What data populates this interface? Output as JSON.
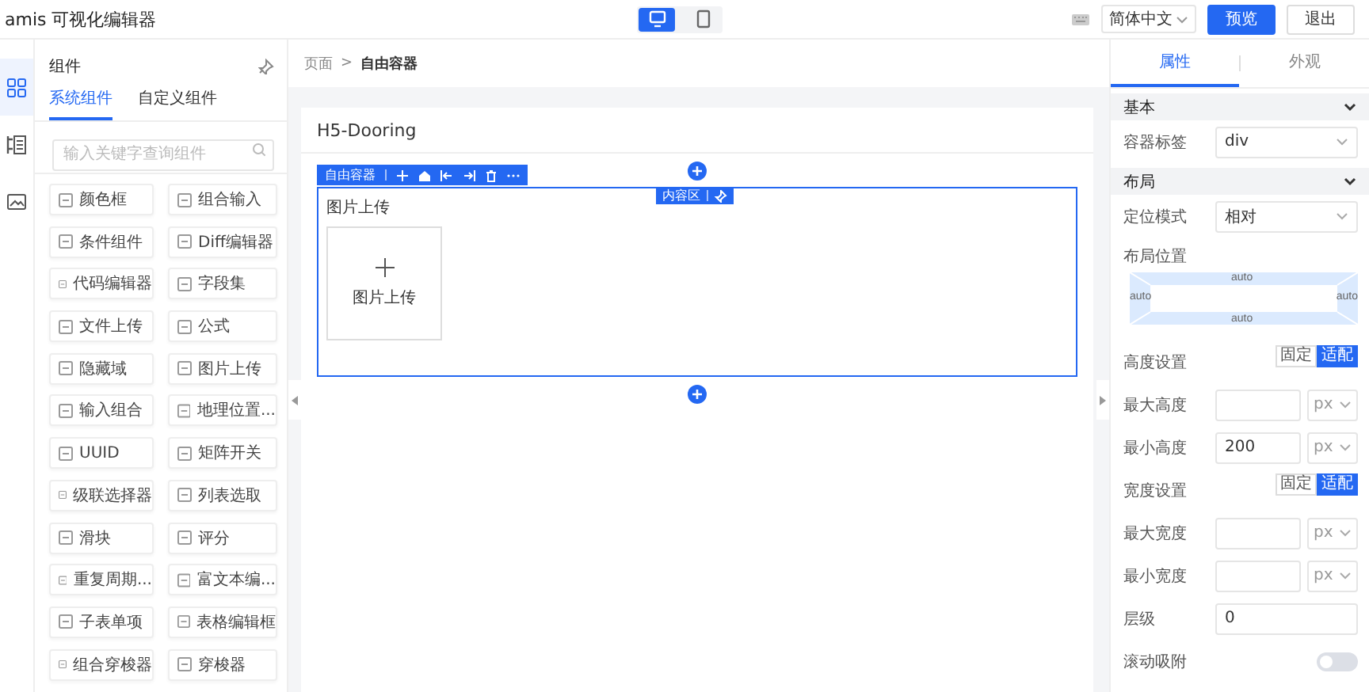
{
  "app": {
    "title": "amis 可视化编辑器"
  },
  "device_toggle": [
    {
      "kind": "desktop",
      "selected": true
    },
    {
      "kind": "mobile",
      "selected": false
    }
  ],
  "language_select": {
    "value": "简体中文"
  },
  "buttons": [
    {
      "label": "预览",
      "kind": "primary"
    },
    {
      "label": "退出",
      "kind": "default"
    }
  ],
  "sidebar_rail": [
    {
      "kind": "grid",
      "selected": true
    },
    {
      "kind": "outline",
      "selected": false
    },
    {
      "kind": "image",
      "selected": false
    }
  ],
  "component_panel": {
    "title": "组件",
    "tabs": [
      {
        "label": "系统组件",
        "selected": true
      },
      {
        "label": "自定义组件",
        "selected": false
      }
    ],
    "search": {
      "placeholder": "输入关键字查询组件"
    },
    "items": [
      {
        "label": "颜色框"
      },
      {
        "label": "组合输入"
      },
      {
        "label": "条件组件"
      },
      {
        "label": "Diff编辑器"
      },
      {
        "label": "代码编辑器"
      },
      {
        "label": "字段集"
      },
      {
        "label": "文件上传"
      },
      {
        "label": "公式"
      },
      {
        "label": "隐藏域"
      },
      {
        "label": "图片上传"
      },
      {
        "label": "输入组合"
      },
      {
        "label": "地理位置..."
      },
      {
        "label": "UUID"
      },
      {
        "label": "矩阵开关"
      },
      {
        "label": "级联选择器"
      },
      {
        "label": "列表选取"
      },
      {
        "label": "滑块"
      },
      {
        "label": "评分"
      },
      {
        "label": "重复周期..."
      },
      {
        "label": "富文本编..."
      },
      {
        "label": "子表单项"
      },
      {
        "label": "表格编辑框"
      },
      {
        "label": "组合穿梭器"
      },
      {
        "label": "穿梭器"
      }
    ]
  },
  "breadcrumb": {
    "items": [
      "页面",
      "自由容器"
    ],
    "separator": ">"
  },
  "canvas": {
    "page_title": "H5-Dooring",
    "container": {
      "label": "自由容器",
      "region_label": "内容区",
      "field_label": "图片上传",
      "upload_label": "图片上传"
    }
  },
  "properties": {
    "tabs": [
      {
        "label": "属性",
        "selected": true
      },
      {
        "label": "外观",
        "selected": false
      }
    ],
    "sections": [
      {
        "title": "基本",
        "expanded": true,
        "rows": [
          {
            "kind": "select",
            "label": "容器标签",
            "value": "div"
          }
        ]
      },
      {
        "title": "布局",
        "expanded": true,
        "rows": [
          {
            "kind": "select",
            "label": "定位模式",
            "value": "相对"
          },
          {
            "kind": "position",
            "label": "布局位置",
            "top": "auto",
            "left": "auto",
            "right": "auto",
            "bottom": "auto"
          },
          {
            "kind": "toggle_group",
            "label": "高度设置",
            "options": [
              {
                "label": "固定",
                "selected": false
              },
              {
                "label": "适配",
                "selected": true
              }
            ]
          },
          {
            "kind": "unit_input",
            "label": "最大高度",
            "unit": "px"
          },
          {
            "kind": "unit_input",
            "label": "最小高度",
            "value": "200",
            "unit": "px"
          },
          {
            "kind": "toggle_group",
            "label": "宽度设置",
            "options": [
              {
                "label": "固定",
                "selected": false
              },
              {
                "label": "适配",
                "selected": true
              }
            ]
          },
          {
            "kind": "unit_input",
            "label": "最大宽度",
            "unit": "px"
          },
          {
            "kind": "unit_input",
            "label": "最小宽度",
            "unit": "px"
          },
          {
            "kind": "input",
            "label": "层级",
            "value": "0"
          },
          {
            "kind": "switch",
            "label": "滚动吸附",
            "on": false
          }
        ]
      }
    ]
  }
}
